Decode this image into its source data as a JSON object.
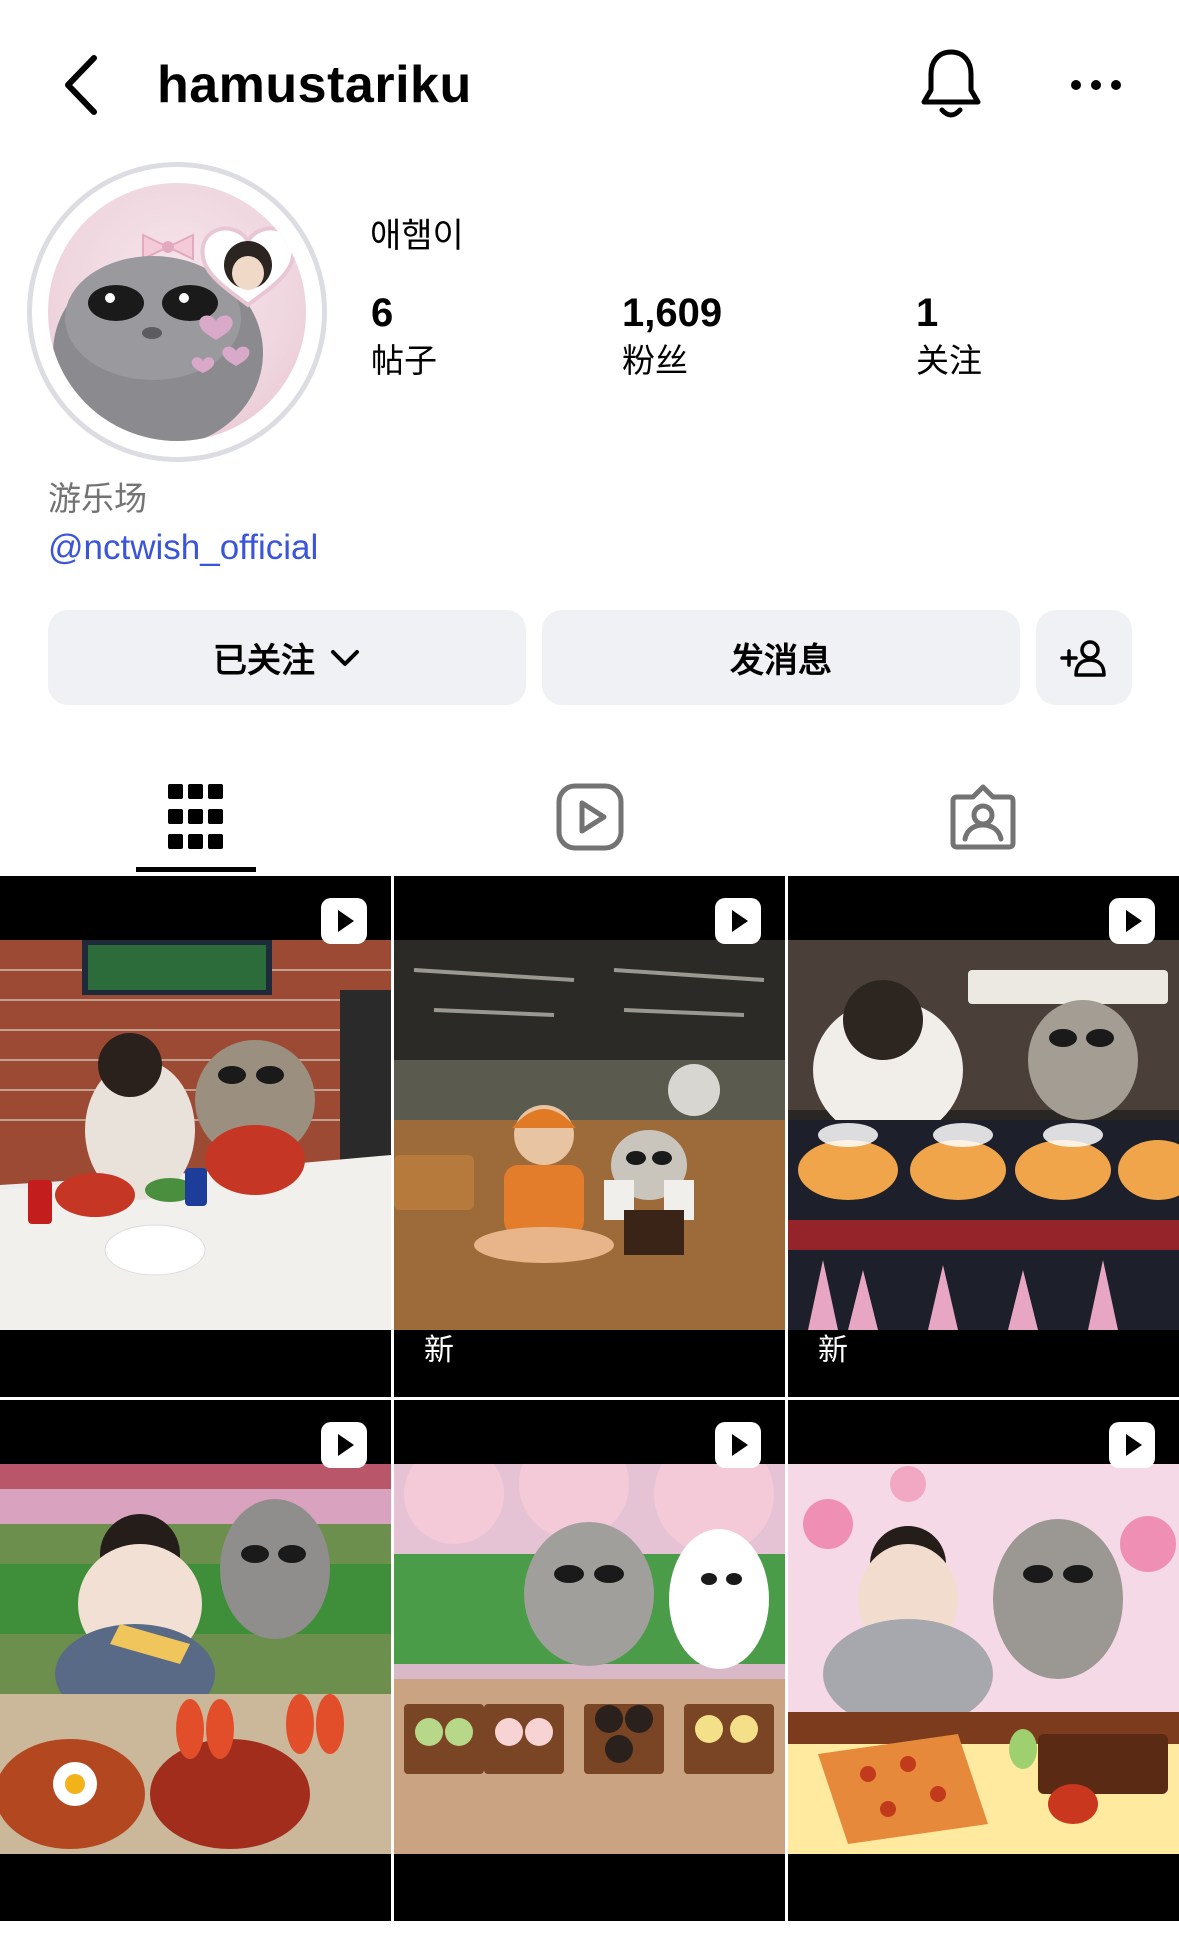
{
  "header": {
    "username": "hamustariku"
  },
  "profile": {
    "display_name": "애햄이",
    "stats": [
      {
        "value": "6",
        "label": "帖子"
      },
      {
        "value": "1,609",
        "label": "粉丝"
      },
      {
        "value": "1",
        "label": "关注"
      }
    ],
    "bio_category": "游乐场",
    "bio_link": "@nctwish_official"
  },
  "actions": {
    "following_label": "已关注",
    "message_label": "发消息"
  },
  "tabs": [
    {
      "icon": "grid-icon",
      "active": true
    },
    {
      "icon": "reels-icon",
      "active": false
    },
    {
      "icon": "tagged-icon",
      "active": false
    }
  ],
  "posts": [
    {
      "type": "reel",
      "tag": ""
    },
    {
      "type": "reel",
      "tag": "新"
    },
    {
      "type": "reel",
      "tag": "新"
    },
    {
      "type": "reel",
      "tag": ""
    },
    {
      "type": "reel",
      "tag": ""
    },
    {
      "type": "reel",
      "tag": ""
    }
  ]
}
